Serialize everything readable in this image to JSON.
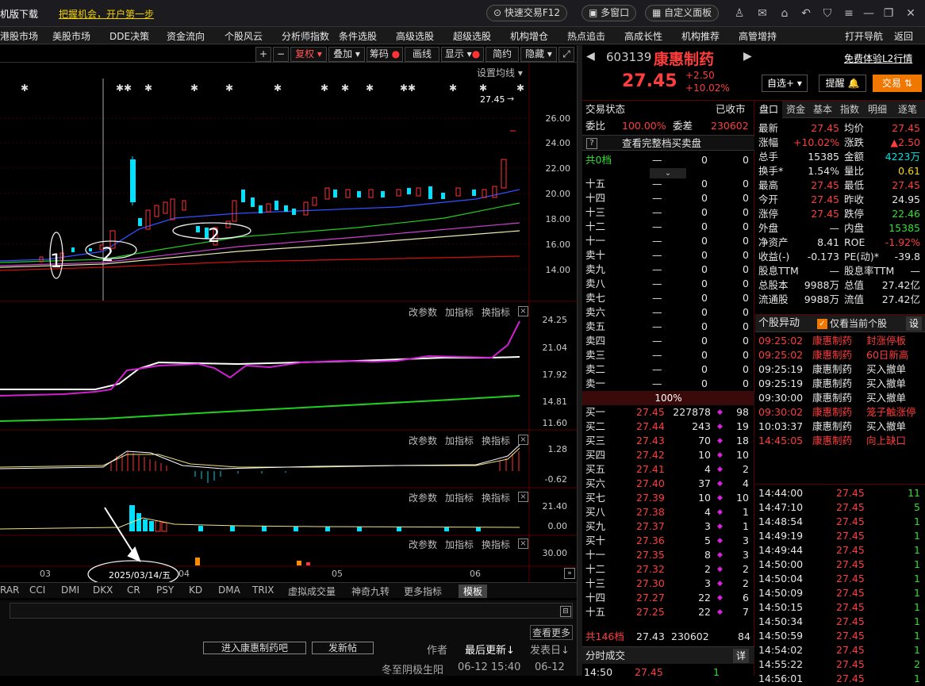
{
  "titlebar": {
    "left_link": "机版下载",
    "promo": "把握机会，开户第一步",
    "quick_trade": "快速交易F12",
    "multi_window": "多窗口",
    "custom_panel": "自定义面板"
  },
  "menu": [
    "港股市场",
    "美股市场",
    "DDE决策",
    "资金流向",
    "个股风云",
    "分析师指数",
    "条件选股",
    "高级选股",
    "超级选股",
    "机构增仓",
    "热点追击",
    "高成长性",
    "机构推荐",
    "高管增持"
  ],
  "menu_right": {
    "nav": "打开导航",
    "back": "返回"
  },
  "chart_toolbar": {
    "plus": "+",
    "minus": "−",
    "fuquan": "复权",
    "overlay": "叠加",
    "chips": "筹码",
    "draw": "画线",
    "display": "显示",
    "simple": "简约",
    "hide": "隐藏"
  },
  "kline": {
    "settings": "设置均线",
    "last_price": "27.45",
    "yticks": [
      "26.00",
      "24.00",
      "22.00",
      "20.00",
      "18.00",
      "16.00",
      "14.00"
    ],
    "annotations": [
      "1",
      "2",
      "2"
    ]
  },
  "panels": [
    {
      "yticks": [
        "24.25",
        "21.04",
        "17.92",
        "14.81",
        "11.60"
      ]
    },
    {
      "yticks": [
        "1.28",
        "-0.62"
      ]
    },
    {
      "yticks": [
        "21.40",
        "0.00"
      ]
    },
    {
      "yticks": [
        "30.00"
      ]
    }
  ],
  "panel_tools": {
    "params": "改参数",
    "add": "加指标",
    "swap": "换指标",
    "close": "×"
  },
  "xaxis": {
    "labels": [
      "03",
      "04",
      "05",
      "06"
    ],
    "cursor_date": "2025/03/14/五"
  },
  "indicator_tabs": [
    "RAR",
    "CCI",
    "DMI",
    "DKX",
    "CR",
    "PSY",
    "KD",
    "DMA",
    "TRIX",
    "虚拟成交量",
    "神奇九转",
    "更多指标",
    "模板"
  ],
  "bottom": {
    "more": "查看更多",
    "enter_bar": "进入康惠制药吧",
    "post": "发新帖",
    "author": "作者",
    "latest": "最后更新",
    "reply": "发表日",
    "footer_text": "冬至阴极生阳",
    "footer_time": "06-12 15:40",
    "footer_date": "06-12"
  },
  "stock": {
    "code": "603139",
    "name": "康惠制药",
    "price": "27.45",
    "change": "+2.50",
    "pct": "+10.02%",
    "free_l2": "免费体验L2行情",
    "watch": "自选+",
    "remind": "提醒",
    "trade": "交易"
  },
  "order": {
    "status_label": "交易状态",
    "status_value": "已收市",
    "ratio_label": "委比",
    "ratio_value": "100.00%",
    "diff_label": "委差",
    "diff_value": "230602",
    "full_book": "查看完整档买卖盘",
    "total_label": "共0档",
    "total_mid": "—",
    "total_a": "0",
    "total_b": "0",
    "asks": [
      [
        "十五",
        "—",
        "0",
        "0"
      ],
      [
        "十四",
        "—",
        "0",
        "0"
      ],
      [
        "十三",
        "—",
        "0",
        "0"
      ],
      [
        "十二",
        "—",
        "0",
        "0"
      ],
      [
        "十一",
        "—",
        "0",
        "0"
      ],
      [
        "卖十",
        "—",
        "0",
        "0"
      ],
      [
        "卖九",
        "—",
        "0",
        "0"
      ],
      [
        "卖八",
        "—",
        "0",
        "0"
      ],
      [
        "卖七",
        "—",
        "0",
        "0"
      ],
      [
        "卖六",
        "—",
        "0",
        "0"
      ],
      [
        "卖五",
        "—",
        "0",
        "0"
      ],
      [
        "卖四",
        "—",
        "0",
        "0"
      ],
      [
        "卖三",
        "—",
        "0",
        "0"
      ],
      [
        "卖二",
        "—",
        "0",
        "0"
      ],
      [
        "卖一",
        "—",
        "0",
        "0"
      ]
    ],
    "mid_pct": "100%",
    "bids": [
      [
        "买一",
        "27.45",
        "227878",
        "98"
      ],
      [
        "买二",
        "27.44",
        "243",
        "19"
      ],
      [
        "买三",
        "27.43",
        "70",
        "18"
      ],
      [
        "买四",
        "27.42",
        "10",
        "10"
      ],
      [
        "买五",
        "27.41",
        "4",
        "2"
      ],
      [
        "买六",
        "27.40",
        "37",
        "4"
      ],
      [
        "买七",
        "27.39",
        "10",
        "10"
      ],
      [
        "买八",
        "27.38",
        "4",
        "1"
      ],
      [
        "买九",
        "27.37",
        "3",
        "1"
      ],
      [
        "买十",
        "27.36",
        "5",
        "3"
      ],
      [
        "十一",
        "27.35",
        "8",
        "3"
      ],
      [
        "十二",
        "27.32",
        "2",
        "2"
      ],
      [
        "十三",
        "27.30",
        "3",
        "2"
      ],
      [
        "十四",
        "27.27",
        "22",
        "6"
      ],
      [
        "十五",
        "27.25",
        "22",
        "7"
      ]
    ],
    "bottom_label": "共146档",
    "bottom_price": "27.43",
    "bottom_vol": "230602",
    "bottom_cnt": "84",
    "tick_title": "分时成交",
    "tick_btn": "详",
    "tick_row": [
      "14:50",
      "27.45",
      "1"
    ]
  },
  "info_tabs": [
    "盘口",
    "资金",
    "基本",
    "指数",
    "明细",
    "逐笔"
  ],
  "info": [
    [
      "最新",
      "27.45",
      "均价",
      "27.45"
    ],
    [
      "涨幅",
      "+10.02%",
      "涨跌",
      "▲2.50"
    ],
    [
      "总手",
      "15385",
      "金额",
      "4223万"
    ],
    [
      "换手*",
      "1.54%",
      "量比",
      "0.61"
    ],
    [
      "最高",
      "27.45",
      "最低",
      "27.45"
    ],
    [
      "今开",
      "27.45",
      "昨收",
      "24.95"
    ],
    [
      "涨停",
      "27.45",
      "跌停",
      "22.46"
    ],
    [
      "外盘",
      "—",
      "内盘",
      "15385"
    ],
    [
      "净资产",
      "8.41",
      "ROE",
      "-1.92%"
    ],
    [
      "收益(-)",
      "-0.173",
      "PE(动)*",
      "-39.8"
    ],
    [
      "股息TTM",
      "—",
      "股息率TTM",
      "—"
    ],
    [
      "总股本",
      "9988万",
      "总值",
      "27.42亿"
    ],
    [
      "流通股",
      "9988万",
      "流值",
      "27.42亿"
    ]
  ],
  "abnormal": {
    "title": "个股异动",
    "only_current": "仅看当前个股",
    "settings": "设",
    "rows": [
      [
        "09:25:02",
        "康惠制药",
        "封涨停板"
      ],
      [
        "09:25:02",
        "康惠制药",
        "60日新高"
      ],
      [
        "09:25:19",
        "康惠制药",
        "买入撤单"
      ],
      [
        "09:25:19",
        "康惠制药",
        "买入撤单"
      ],
      [
        "09:30:00",
        "康惠制药",
        "买入撤单"
      ],
      [
        "09:30:02",
        "康惠制药",
        "笼子触涨停"
      ],
      [
        "10:03:37",
        "康惠制药",
        "买入撤单"
      ],
      [
        "14:45:05",
        "康惠制药",
        "向上缺口"
      ]
    ]
  },
  "ticks": [
    [
      "14:44:00",
      "27.45",
      "11"
    ],
    [
      "14:47:10",
      "27.45",
      "5"
    ],
    [
      "14:48:54",
      "27.45",
      "1"
    ],
    [
      "14:49:19",
      "27.45",
      "1"
    ],
    [
      "14:49:44",
      "27.45",
      "1"
    ],
    [
      "14:50:00",
      "27.45",
      "1"
    ],
    [
      "14:50:04",
      "27.45",
      "1"
    ],
    [
      "14:50:09",
      "27.45",
      "1"
    ],
    [
      "14:50:15",
      "27.45",
      "1"
    ],
    [
      "14:50:34",
      "27.45",
      "1"
    ],
    [
      "14:50:59",
      "27.45",
      "1"
    ],
    [
      "14:54:02",
      "27.45",
      "1"
    ],
    [
      "14:55:22",
      "27.45",
      "2"
    ],
    [
      "14:56:01",
      "27.45",
      "1"
    ]
  ]
}
